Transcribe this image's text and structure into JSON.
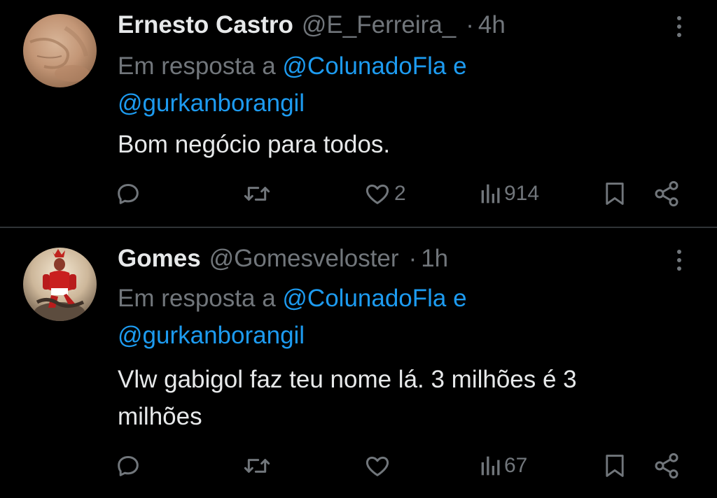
{
  "tweets": [
    {
      "display_name": "Ernesto Castro",
      "handle": "@E_Ferreira_",
      "separator": "·",
      "time": "4h",
      "reply_prefix": "Em resposta a",
      "mention_1": "@ColunadoFla",
      "mention_joiner": "e",
      "mention_2": "@gurkanborangil",
      "text": "Bom negócio para todos.",
      "likes": "2",
      "views": "914",
      "avatar_icon": "face-closeup-photo"
    },
    {
      "display_name": "Gomes",
      "handle": "@Gomesveloster",
      "separator": "·",
      "time": "1h",
      "reply_prefix": "Em resposta a",
      "mention_1": "@ColunadoFla",
      "mention_joiner": "e",
      "mention_2": "@gurkanborangil",
      "text": "Vlw gabigol faz teu nome lá. 3 milhões é 3 milhões",
      "likes": "",
      "views": "67",
      "avatar_icon": "red-warrior-figure-photo"
    }
  ],
  "icons": {
    "reply": "reply-icon",
    "retweet": "retweet-icon",
    "like": "heart-icon",
    "views": "views-icon",
    "bookmark": "bookmark-icon",
    "share": "share-icon",
    "more": "more-vertical-icon"
  },
  "colors": {
    "background": "#000000",
    "text_primary": "#e7e9ea",
    "text_secondary": "#71767b",
    "link": "#1d9bf0",
    "divider": "#2f3336"
  }
}
